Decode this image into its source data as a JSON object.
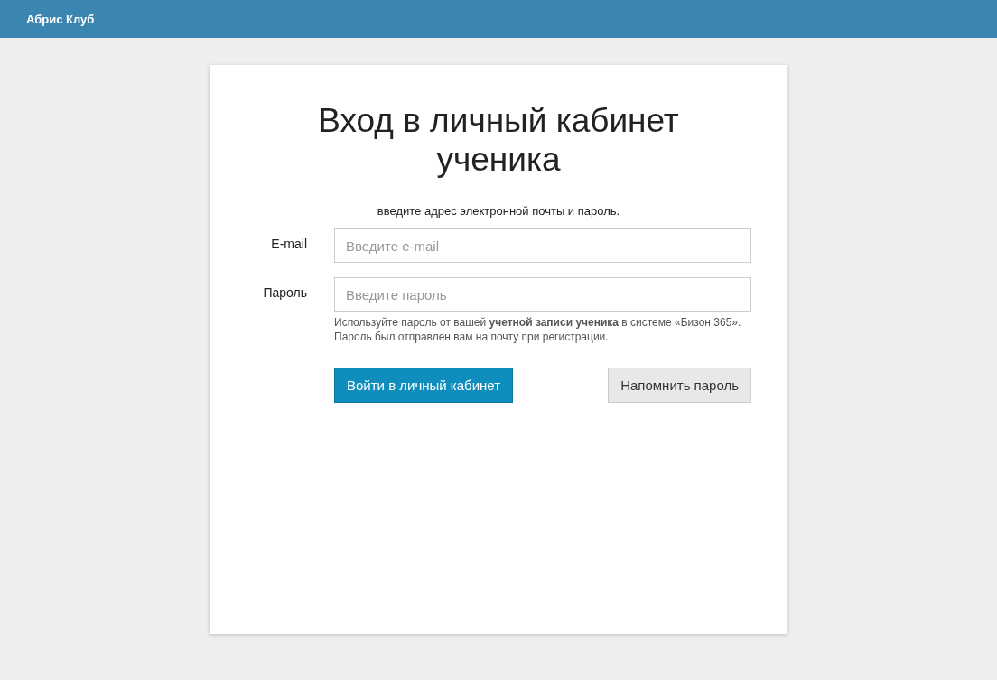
{
  "header": {
    "brand": "Абрис Клуб"
  },
  "login": {
    "title": "Вход в личный кабинет ученика",
    "subtitle": "введите адрес электронной почты и пароль.",
    "fields": [
      {
        "label": "E-mail",
        "placeholder": "Введите e-mail"
      },
      {
        "label": "Пароль",
        "placeholder": "Введите пароль"
      }
    ],
    "hint": "Используйте пароль от вашей **учетной записи ученика** в системе «Бизон 365».",
    "hint_2": "Пароль был отправлен вам на почту при регистрации.",
    "buttons": [
      {
        "label": "Войти в личный кабинет",
        "kind": "primary"
      },
      {
        "label": "Напомнить пароль",
        "kind": "secondary"
      }
    ]
  }
}
